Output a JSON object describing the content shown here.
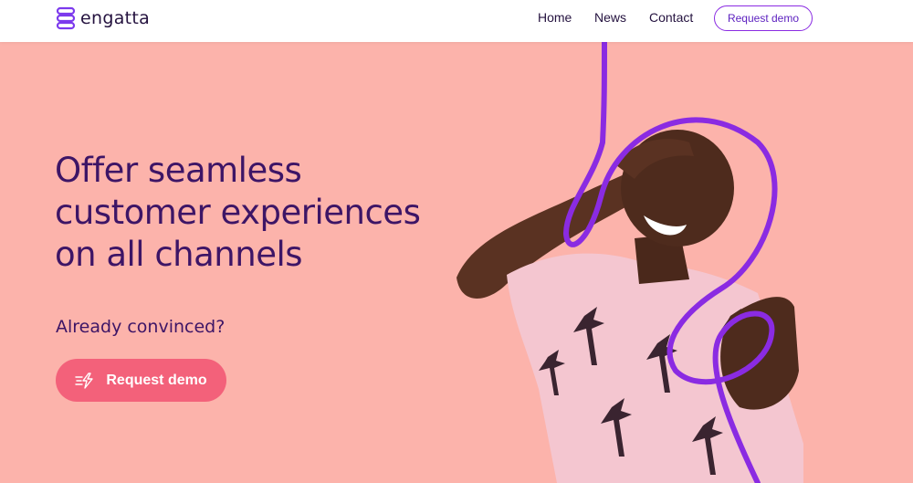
{
  "brand": {
    "name": "engatta"
  },
  "nav": {
    "links": [
      {
        "label": "Home"
      },
      {
        "label": "News"
      },
      {
        "label": "Contact"
      }
    ],
    "demo_button": "Request demo"
  },
  "hero": {
    "title_lines": [
      "Offer seamless",
      "customer experiences",
      "on all channels"
    ],
    "subtitle": "Already convinced?",
    "cta_label": "Request demo"
  },
  "colors": {
    "background": "#fcb3ab",
    "heading": "#3d1566",
    "accent_purple": "#8a2be2",
    "cta": "#f3617a"
  },
  "icons": {
    "logo": "engatta-logo-icon",
    "cta": "lightning-icon"
  }
}
